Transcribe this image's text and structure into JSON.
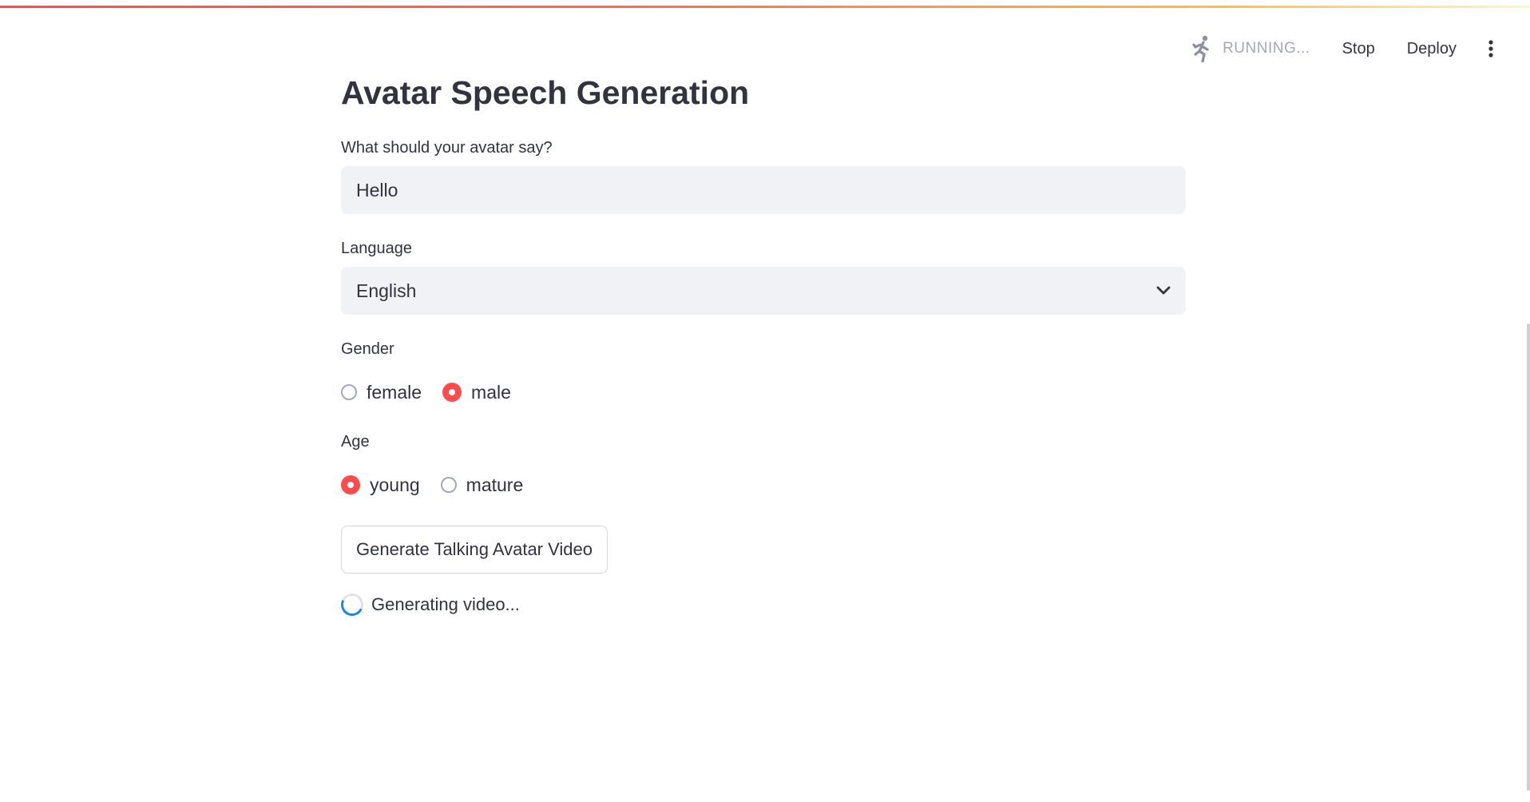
{
  "colors": {
    "accent": "#ff4b4b",
    "input_bg": "#f0f2f6",
    "text": "#31333f",
    "muted": "#a3a8b8",
    "spinner": "#1c83e1"
  },
  "toolbar": {
    "status_icon": "running-person-icon",
    "status_text": "RUNNING...",
    "stop_label": "Stop",
    "deploy_label": "Deploy",
    "menu_icon": "vertical-ellipsis-icon"
  },
  "page": {
    "title": "Avatar Speech Generation"
  },
  "speech_input": {
    "label": "What should your avatar say?",
    "value": "Hello"
  },
  "language": {
    "label": "Language",
    "selected": "English",
    "icon": "chevron-down-icon"
  },
  "gender": {
    "label": "Gender",
    "options": [
      {
        "label": "female",
        "checked": false
      },
      {
        "label": "male",
        "checked": true
      }
    ]
  },
  "age": {
    "label": "Age",
    "options": [
      {
        "label": "young",
        "checked": true
      },
      {
        "label": "mature",
        "checked": false
      }
    ]
  },
  "generate": {
    "button_label": "Generate Talking Avatar Video"
  },
  "status": {
    "spinner_text": "Generating video..."
  }
}
